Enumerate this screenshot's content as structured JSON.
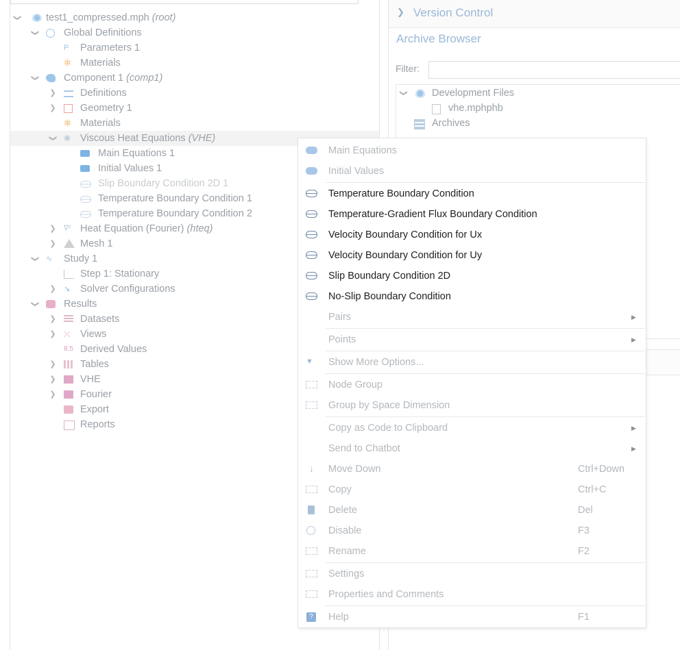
{
  "tree": {
    "root": {
      "label": "test1_compressed.mph",
      "tag": "(root)"
    },
    "global_definitions": "Global Definitions",
    "parameters": "Parameters 1",
    "materials_global": "Materials",
    "component": {
      "label": "Component 1",
      "tag": "(comp1)"
    },
    "definitions": "Definitions",
    "geometry": "Geometry 1",
    "materials_comp": "Materials",
    "vhe": {
      "label": "Viscous Heat Equations",
      "tag": "(VHE)"
    },
    "main_equations": "Main Equations 1",
    "initial_values": "Initial Values 1",
    "slip_bc": "Slip Boundary Condition 2D 1",
    "temp_bc_1": "Temperature Boundary Condition 1",
    "temp_bc_2": "Temperature Boundary Condition 2",
    "heat_eq": {
      "label": "Heat Equation (Fourier)",
      "tag": "(hteq)"
    },
    "mesh": "Mesh 1",
    "study": "Study 1",
    "step": "Step 1: Stationary",
    "solver": "Solver Configurations",
    "results": "Results",
    "datasets": "Datasets",
    "views": "Views",
    "derived_values": "Derived Values",
    "tables": "Tables",
    "vhe_plot": "VHE",
    "fourier_plot": "Fourier",
    "export": "Export",
    "reports": "Reports"
  },
  "right_panel": {
    "version_control": "Version Control",
    "archive_browser": "Archive Browser",
    "filter_label": "Filter:",
    "filter_value": "",
    "development_files": "Development Files",
    "file": "vhe.mphphb",
    "archives": "Archives"
  },
  "context_menu": {
    "main_equations": "Main Equations",
    "initial_values": "Initial Values",
    "temp_bc": "Temperature Boundary Condition",
    "temp_grad_flux_bc": "Temperature-Gradient Flux Boundary Condition",
    "vel_bc_ux": "Velocity Boundary Condition for Ux",
    "vel_bc_uy": "Velocity Boundary Condition for Uy",
    "slip_bc_2d": "Slip Boundary Condition 2D",
    "no_slip_bc": "No-Slip Boundary Condition",
    "pairs": "Pairs",
    "points": "Points",
    "show_more": "Show More Options...",
    "node_group": "Node Group",
    "group_by_space": "Group by Space Dimension",
    "copy_as_code": "Copy as Code to Clipboard",
    "send_to_chatbot": "Send to Chatbot",
    "move_down": {
      "label": "Move Down",
      "shortcut": "Ctrl+Down"
    },
    "copy": {
      "label": "Copy",
      "shortcut": "Ctrl+C"
    },
    "delete": {
      "label": "Delete",
      "shortcut": "Del"
    },
    "disable": {
      "label": "Disable",
      "shortcut": "F3"
    },
    "rename": {
      "label": "Rename",
      "shortcut": "F2"
    },
    "settings": "Settings",
    "properties": "Properties and Comments",
    "help": {
      "label": "Help",
      "shortcut": "F1"
    }
  },
  "colors": {
    "accent": "#9ab8d8",
    "enabled_text": "#1e1e1e",
    "disabled_text": "#b4b8bc"
  }
}
